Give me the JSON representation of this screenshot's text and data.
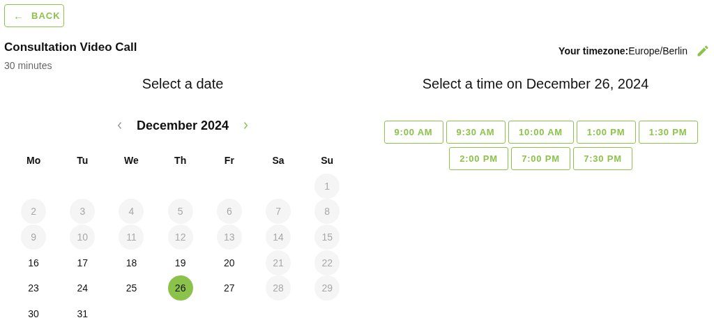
{
  "back_button": {
    "icon": "←",
    "label": "BACK"
  },
  "event": {
    "title": "Consultation Video Call",
    "duration": "30 minutes"
  },
  "timezone": {
    "label": "Your timezone:",
    "value": "Europe/Berlin"
  },
  "date_picker": {
    "heading": "Select a date",
    "month": "December 2024",
    "prev_disabled": true,
    "weekdays": [
      "Mo",
      "Tu",
      "We",
      "Th",
      "Fr",
      "Sa",
      "Su"
    ],
    "days": [
      {
        "kind": "blank"
      },
      {
        "kind": "blank"
      },
      {
        "kind": "blank"
      },
      {
        "kind": "blank"
      },
      {
        "kind": "blank"
      },
      {
        "kind": "blank"
      },
      {
        "label": "1",
        "disabled": true,
        "selected": false
      },
      {
        "label": "2",
        "disabled": true,
        "selected": false
      },
      {
        "label": "3",
        "disabled": true,
        "selected": false
      },
      {
        "label": "4",
        "disabled": true,
        "selected": false
      },
      {
        "label": "5",
        "disabled": true,
        "selected": false
      },
      {
        "label": "6",
        "disabled": true,
        "selected": false
      },
      {
        "label": "7",
        "disabled": true,
        "selected": false
      },
      {
        "label": "8",
        "disabled": true,
        "selected": false
      },
      {
        "label": "9",
        "disabled": true,
        "selected": false
      },
      {
        "label": "10",
        "disabled": true,
        "selected": false
      },
      {
        "label": "11",
        "disabled": true,
        "selected": false
      },
      {
        "label": "12",
        "disabled": true,
        "selected": false
      },
      {
        "label": "13",
        "disabled": true,
        "selected": false
      },
      {
        "label": "14",
        "disabled": true,
        "selected": false
      },
      {
        "label": "15",
        "disabled": true,
        "selected": false
      },
      {
        "label": "16",
        "disabled": false,
        "selected": false
      },
      {
        "label": "17",
        "disabled": false,
        "selected": false
      },
      {
        "label": "18",
        "disabled": false,
        "selected": false
      },
      {
        "label": "19",
        "disabled": false,
        "selected": false
      },
      {
        "label": "20",
        "disabled": false,
        "selected": false
      },
      {
        "label": "21",
        "disabled": true,
        "selected": false
      },
      {
        "label": "22",
        "disabled": true,
        "selected": false
      },
      {
        "label": "23",
        "disabled": false,
        "selected": false
      },
      {
        "label": "24",
        "disabled": false,
        "selected": false
      },
      {
        "label": "25",
        "disabled": false,
        "selected": false
      },
      {
        "label": "26",
        "disabled": false,
        "selected": true
      },
      {
        "label": "27",
        "disabled": false,
        "selected": false
      },
      {
        "label": "28",
        "disabled": true,
        "selected": false
      },
      {
        "label": "29",
        "disabled": true,
        "selected": false
      },
      {
        "label": "30",
        "disabled": false,
        "selected": false
      },
      {
        "label": "31",
        "disabled": false,
        "selected": false
      }
    ]
  },
  "time_picker": {
    "heading": "Select a time on December 26, 2024",
    "slots": [
      "9:00 AM",
      "9:30 AM",
      "10:00 AM",
      "1:00 PM",
      "1:30 PM",
      "2:00 PM",
      "7:00 PM",
      "7:30 PM"
    ]
  }
}
